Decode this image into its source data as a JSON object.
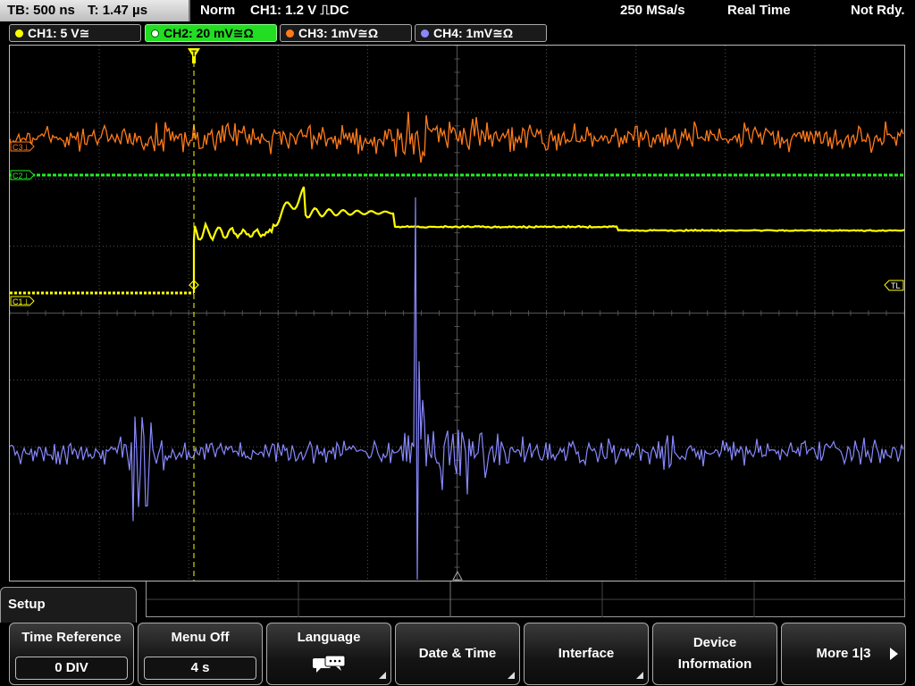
{
  "topbar": {
    "timebase": "TB: 500 ns",
    "trigger_time": "T: 1.47 µs",
    "mode": "Norm",
    "trigger": "CH1: 1.2 V ⎍DC",
    "sample_rate": "250 MSa/s",
    "acq_mode": "Real Time",
    "status": "Not Rdy."
  },
  "channels": [
    {
      "label": "CH1: 5 V≅",
      "color": "#ffff00"
    },
    {
      "label": "CH2: 20 mV≅Ω",
      "color": "#22ee22"
    },
    {
      "label": "CH3: 1mV≅Ω",
      "color": "#ff7a1a"
    },
    {
      "label": "CH4: 1mV≅Ω",
      "color": "#8888ff"
    }
  ],
  "markers": {
    "c3": "C3⊥",
    "c2": "C2⊥",
    "c1": "C1⊥",
    "trigger_level": "TL",
    "trigger_pos": "T"
  },
  "menu": {
    "title": "Setup",
    "buttons": [
      {
        "label": "Time Reference",
        "value": "0 DIV"
      },
      {
        "label": "Menu Off",
        "value": "4 s"
      },
      {
        "label": "Language"
      },
      {
        "label": "Date & Time"
      },
      {
        "label": "Interface"
      },
      {
        "label": "Device Information"
      },
      {
        "label": "More 1|3"
      }
    ]
  },
  "colors": {
    "ch1": "#ffff00",
    "ch2": "#22ee22",
    "ch3": "#ff7a1a",
    "ch4": "#8888ff",
    "grid": "#555555"
  }
}
